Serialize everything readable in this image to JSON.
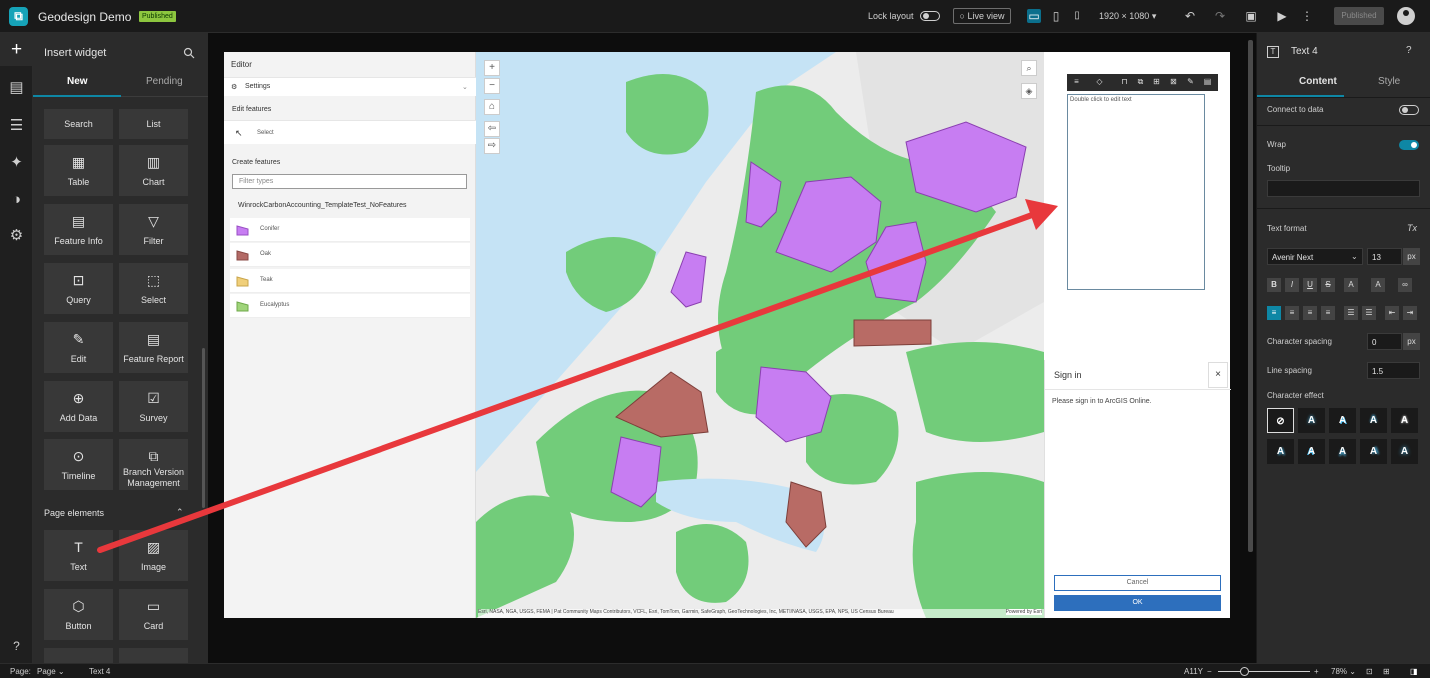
{
  "app": {
    "title": "Geodesign Demo",
    "badge": "Published"
  },
  "topbar": {
    "lock_layout": "Lock layout",
    "live_view": "Live view",
    "resolution": "1920 × 1080",
    "published_button": "Published"
  },
  "left_panel": {
    "title": "Insert widget",
    "tabs": [
      "New",
      "Pending"
    ],
    "widgets": [
      {
        "label": "Search",
        "icon": ""
      },
      {
        "label": "List",
        "icon": ""
      },
      {
        "label": "Table",
        "icon": "▦"
      },
      {
        "label": "Chart",
        "icon": "▥"
      },
      {
        "label": "Feature Info",
        "icon": "▤"
      },
      {
        "label": "Filter",
        "icon": "▽"
      },
      {
        "label": "Query",
        "icon": "⊡"
      },
      {
        "label": "Select",
        "icon": "⬚"
      },
      {
        "label": "Edit",
        "icon": "✎"
      },
      {
        "label": "Feature Report",
        "icon": "▤"
      },
      {
        "label": "Add Data",
        "icon": "⊕"
      },
      {
        "label": "Survey",
        "icon": "☑"
      },
      {
        "label": "Timeline",
        "icon": "⊙"
      },
      {
        "label": "Branch Version Management",
        "icon": "⧉"
      }
    ],
    "section": "Page elements",
    "page_elements": [
      {
        "label": "Text",
        "icon": "T"
      },
      {
        "label": "Image",
        "icon": "▨"
      },
      {
        "label": "Button",
        "icon": "⬡"
      },
      {
        "label": "Card",
        "icon": "▭"
      }
    ]
  },
  "editor": {
    "title": "Editor",
    "settings": "Settings",
    "edit_features": "Edit features",
    "select": "Select",
    "create_features": "Create features",
    "filter_placeholder": "Filter types",
    "layer": "WinrockCarbonAccounting_TemplateTest_NoFeatures",
    "feature_types": [
      {
        "name": "Conifer",
        "color": "#c77df2"
      },
      {
        "name": "Oak",
        "color": "#b36a66"
      },
      {
        "name": "Teak",
        "color": "#f0cf7a"
      },
      {
        "name": "Eucalyptus",
        "color": "#9fd47a"
      }
    ]
  },
  "map": {
    "attribution": "Esri, NASA, NGA, USGS, FEMA | Pat Community Maps Contributors, VCFL, Esri, TomTom, Garmin, SafeGraph, GeoTechnologies, Inc, METI/NASA, USGS, EPA, NPS, US Census Bureau",
    "powered": "Powered by Esri"
  },
  "text_widget": {
    "placeholder": "Double click to edit text"
  },
  "signin": {
    "title": "Sign in",
    "message": "Please sign in to ArcGIS Online.",
    "cancel": "Cancel",
    "ok": "OK"
  },
  "right_panel": {
    "title": "Text 4",
    "tabs": [
      "Content",
      "Style"
    ],
    "connect_to_data": "Connect to data",
    "wrap": "Wrap",
    "tooltip": "Tooltip",
    "text_format": "Text format",
    "font": "Avenir Next",
    "font_size": "13",
    "unit": "px",
    "char_spacing_label": "Character spacing",
    "char_spacing": "0",
    "line_spacing_label": "Line spacing",
    "line_spacing": "1.5",
    "char_effect": "Character effect"
  },
  "status": {
    "page_label": "Page:",
    "page_value": "Page",
    "selected": "Text 4",
    "a11y": "A11Y",
    "zoom": "78%"
  }
}
